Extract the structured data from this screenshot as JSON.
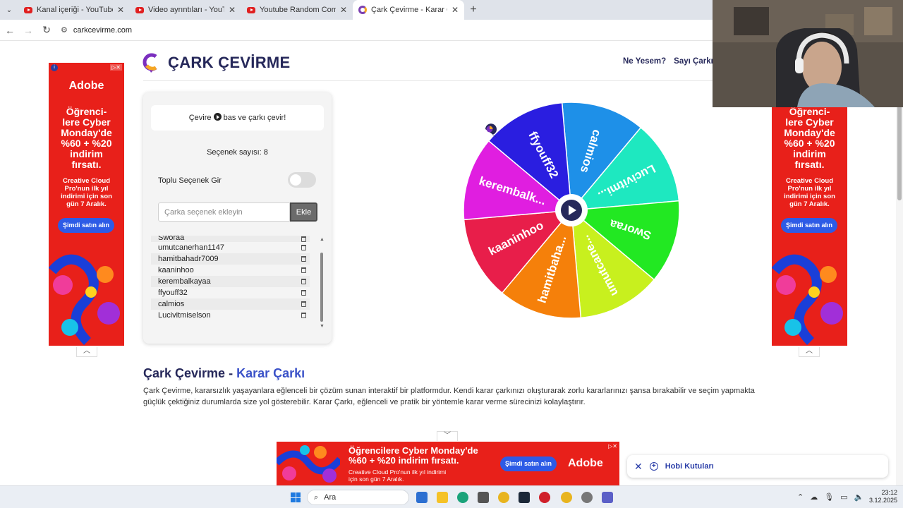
{
  "browser": {
    "tabs": [
      {
        "title": "Kanal içeriği - YouTube Studio",
        "icon": "youtube-icon",
        "active": false
      },
      {
        "title": "Video ayrıntıları - YouTube Studio",
        "icon": "youtube-icon",
        "active": false
      },
      {
        "title": "Youtube Random Comment Picker",
        "icon": "youtube-icon",
        "active": false
      },
      {
        "title": "Çark Çevirme - Karar Çarkı!",
        "icon": "carkcevirme-icon",
        "active": true
      }
    ],
    "new_tab": "+",
    "url": "carkcevirme.com"
  },
  "site": {
    "logo_text": "ÇARK ÇEVİRME",
    "nav": [
      "Ne Yesem?",
      "Sayı Çarkı",
      "T"
    ]
  },
  "panel": {
    "hint_before": "Çevire",
    "hint_after": "bas ve çarkı çevir!",
    "count_label": "Seçenek sayısı: 8",
    "bulk_label": "Toplu Seçenek Gir",
    "bulk_enabled": false,
    "input_placeholder": "Çarka seçenek ekleyin",
    "add_button": "Ekle",
    "items": [
      "Sworaa",
      "umutcanerhan1147",
      "hamitbahadr7009",
      "kaaninhoo",
      "kerembalkayaa",
      "ffyouff32",
      "calmios",
      "Lucivitmiselson"
    ]
  },
  "wheel": {
    "segments": [
      {
        "label": "calmios",
        "color": "#1e90e8"
      },
      {
        "label": "Lucivitmi...",
        "color": "#1ee8c0"
      },
      {
        "label": "Sworaa",
        "color": "#22e822"
      },
      {
        "label": "umutcane...",
        "color": "#c8f01e"
      },
      {
        "label": "hamitbaha...",
        "color": "#f5800a"
      },
      {
        "label": "kaaninhoo",
        "color": "#e81e4a"
      },
      {
        "label": "kerembalk...",
        "color": "#e01ee0"
      },
      {
        "label": "ffyouff32",
        "color": "#2a1ee0"
      }
    ]
  },
  "article": {
    "title_main": "Çark Çevirme - ",
    "title_accent": "Karar Çarkı",
    "paragraph": "Çark Çevirme, kararsızlık yaşayanlara eğlenceli bir çözüm sunan interaktif bir platformdur. Kendi karar çarkınızı oluşturarak zorlu kararlarınızı şansa bırakabilir ve seçim yapmakta güçlük çektiğiniz durumlarda size yol gösterebilir. Karar Çarkı, eğlenceli ve pratik bir yöntemle karar verme sürecinizi kolaylaştırır."
  },
  "ad_side": {
    "brand": "Adobe",
    "headline": "Öğrenci-\nlere Cyber\nMonday'de\n%60 + %20\nindirim\nfırsatı.",
    "sub": "Creative Cloud\nPro'nun ilk yıl\nindirimi için son\ngün 7 Aralık.",
    "cta": "Şimdi satın alın"
  },
  "ad_bottom": {
    "headline": "Öğrencilere Cyber Monday'de\n%60 + %20 indirim fırsatı.",
    "sub": "Creative Cloud Pro'nun ilk yıl indirimi\niçin son gün 7 Aralık.",
    "cta": "Şimdi satın alın",
    "brand": "Adobe"
  },
  "hobi": {
    "label": "Hobi Kutuları"
  },
  "taskbar": {
    "search_placeholder": "Ara",
    "time": "23:12",
    "date": "3.12.2025"
  },
  "colors": {
    "brand": "#26285a",
    "accent": "#3b52c8",
    "ad_red": "#e8201a",
    "cta_blue": "#2d5be6"
  }
}
